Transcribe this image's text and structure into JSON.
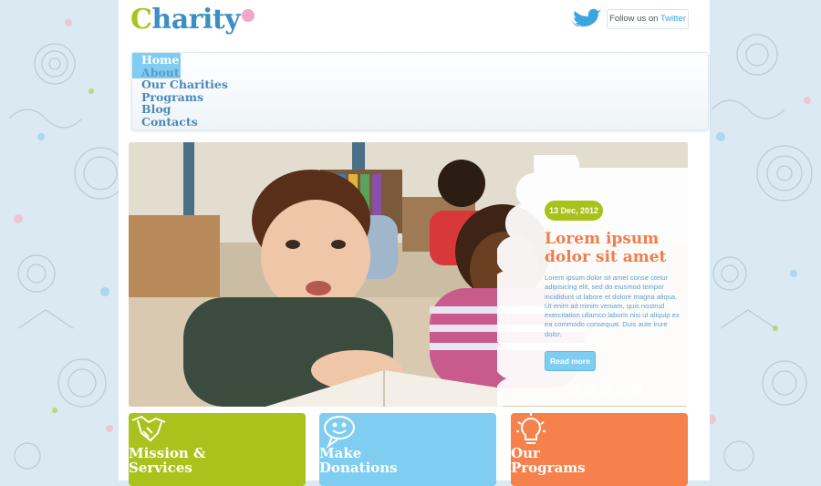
{
  "header": {
    "logo_first": "C",
    "logo_rest": "harity",
    "follow_prefix": "Follow us on ",
    "follow_link": "Twitter"
  },
  "nav": {
    "items": [
      {
        "label": "Home"
      },
      {
        "label": "About"
      },
      {
        "label": "Our Charities"
      },
      {
        "label": "Programs"
      },
      {
        "label": "Blog"
      },
      {
        "label": "Contacts"
      }
    ]
  },
  "slider": {
    "date": "13 Dec, 2012",
    "title": "Lorem ipsum dolor sit amet",
    "text": "Lorem ipsum dolor sit amet conse ctetur adipisicing elit, sed do eiusmod tempor incididunt ut labore et dolore magna aliqua. Ut enim ad minim veniam, quis nostrud exercitation ullamco laboris nisi ut aliquip ex ea commodo consequat. Duis aute irure dolor.",
    "read_more": "Read more",
    "active_slide": 5
  },
  "cards": [
    {
      "line1": "Mission &",
      "line2": "Services",
      "icon": "handshake-icon"
    },
    {
      "line1": "Make",
      "line2": "Donations",
      "icon": "smile-bubble-icon"
    },
    {
      "line1": "Our",
      "line2": "Programs",
      "icon": "lightbulb-icon"
    }
  ],
  "colors": {
    "green": "#a9c31c",
    "blue": "#7fcdf0",
    "orange": "#f6814c",
    "title_orange": "#f17d4a",
    "link_blue": "#4a89b8"
  }
}
